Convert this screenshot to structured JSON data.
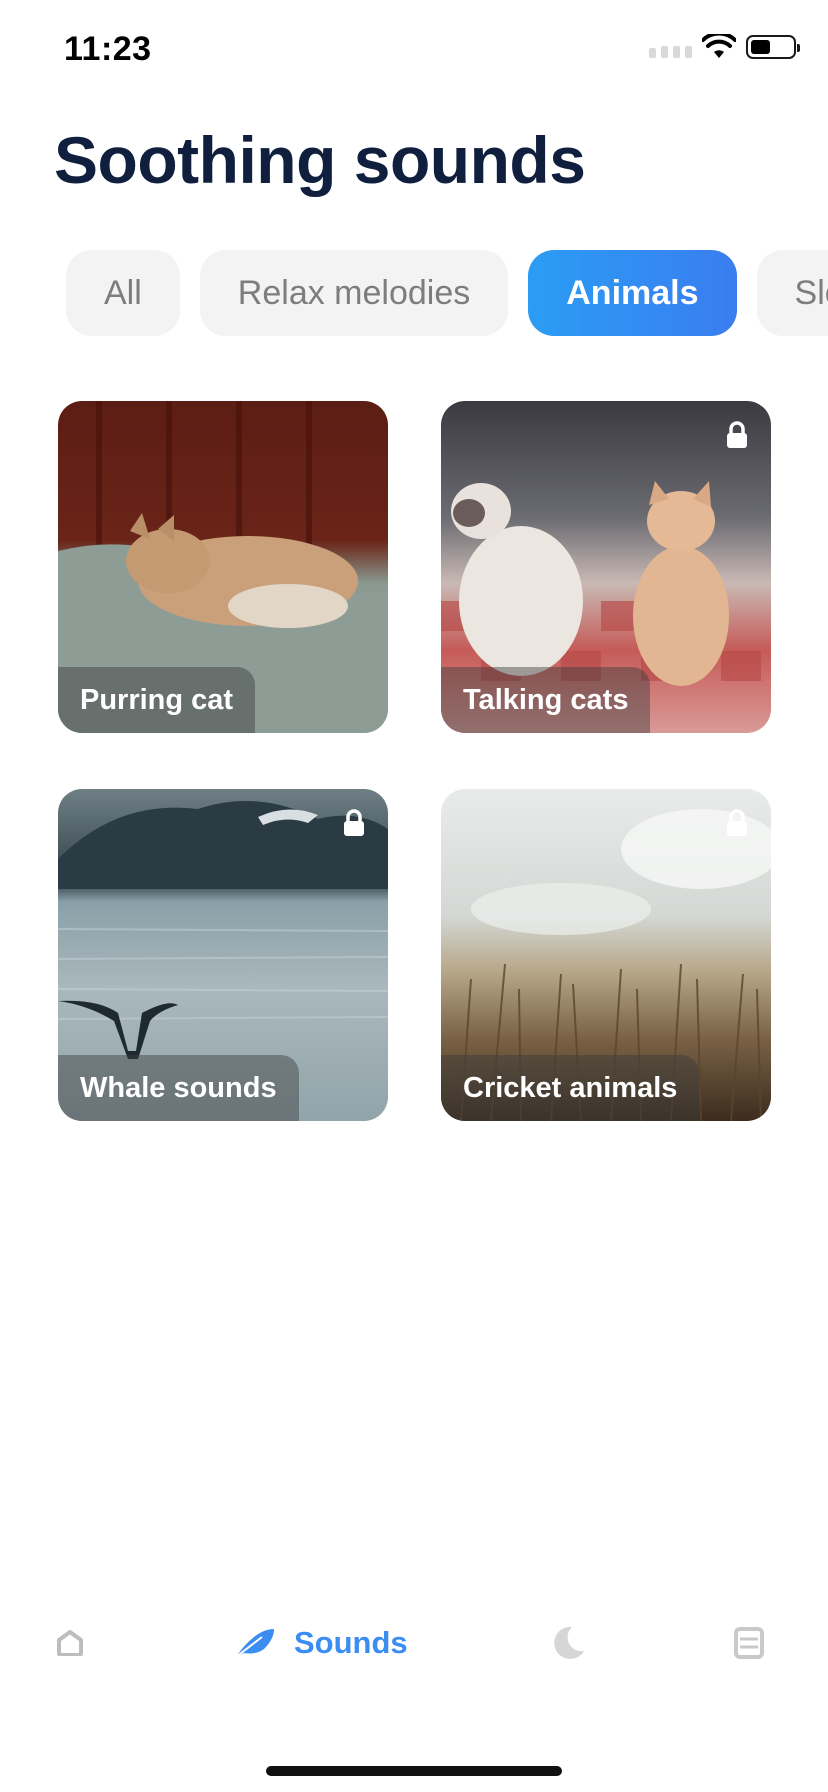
{
  "status_bar": {
    "time": "11:23"
  },
  "header": {
    "title": "Soothing sounds"
  },
  "filters": [
    {
      "label": "All",
      "active": false
    },
    {
      "label": "Relax melodies",
      "active": false
    },
    {
      "label": "Animals",
      "active": true
    },
    {
      "label": "Sle",
      "active": false
    }
  ],
  "cards": [
    {
      "title": "Purring cat",
      "locked": false
    },
    {
      "title": "Talking cats",
      "locked": true
    },
    {
      "title": "Whale sounds",
      "locked": true
    },
    {
      "title": "Cricket animals",
      "locked": true
    }
  ],
  "tab_bar": {
    "items": [
      {
        "icon": "home-icon",
        "label": ""
      },
      {
        "icon": "feather-icon",
        "label": "Sounds",
        "active": true
      },
      {
        "icon": "moon-icon",
        "label": ""
      },
      {
        "icon": "book-icon",
        "label": ""
      }
    ]
  },
  "colors": {
    "accent": "#3b8df2",
    "title": "#0f1f3d",
    "chip_bg": "#f3f3f3",
    "chip_text": "#7d7d7d"
  }
}
